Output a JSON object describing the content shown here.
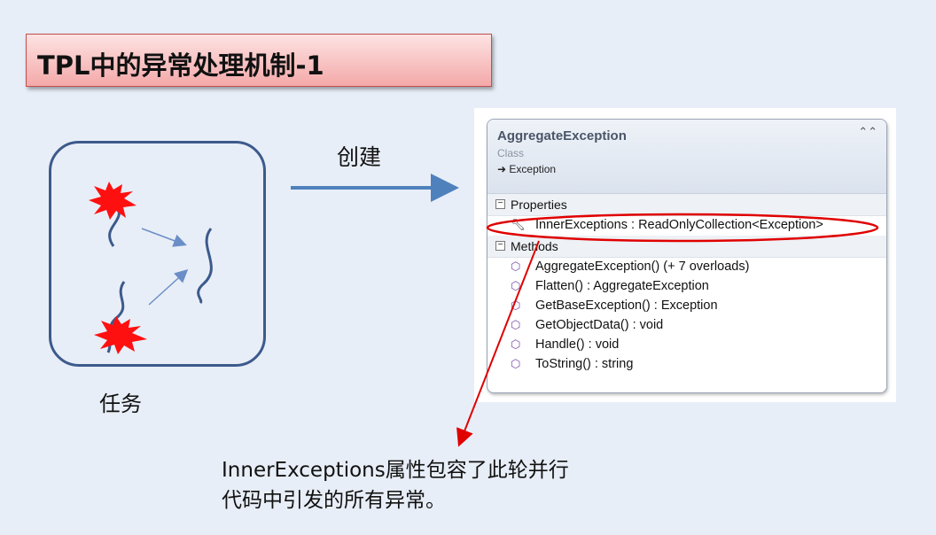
{
  "title": "TPL中的异常处理机制-1",
  "task_label": "任务",
  "create_label": "创建",
  "class_card": {
    "name": "AggregateException",
    "kind": "Class",
    "base": "Exception",
    "sections": {
      "properties_label": "Properties",
      "methods_label": "Methods"
    },
    "properties": [
      "InnerExceptions : ReadOnlyCollection<Exception>"
    ],
    "methods": [
      "AggregateException() (+ 7 overloads)",
      "Flatten() : AggregateException",
      "GetBaseException() : Exception",
      "GetObjectData() : void",
      "Handle() : void",
      "ToString() : string"
    ]
  },
  "note": {
    "line1": "InnerExceptions属性包容了此轮并行",
    "line2": "代码中引发的所有异常。"
  },
  "colors": {
    "background": "#e8eef7",
    "title_fill": "#f4a9a9",
    "arrow_blue": "#4f81bd",
    "highlight_red": "#e00000"
  }
}
